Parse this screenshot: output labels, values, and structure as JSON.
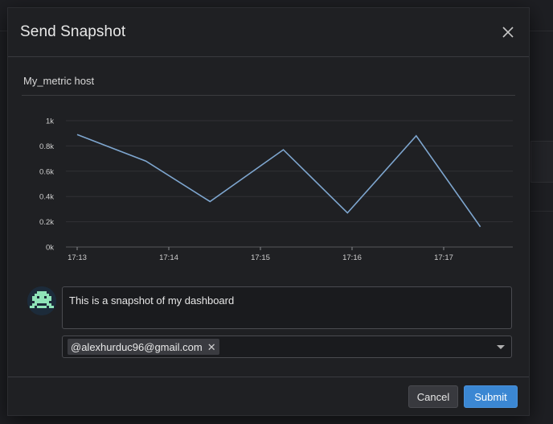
{
  "modal": {
    "title": "Send Snapshot",
    "close_icon": "close-icon"
  },
  "panel": {
    "title": "My_metric host"
  },
  "chart_data": {
    "type": "line",
    "title": "",
    "xlabel": "",
    "ylabel": "",
    "x_tick_labels": [
      "17:13",
      "17:14",
      "17:15",
      "17:16",
      "17:17"
    ],
    "y_tick_labels": [
      "0k",
      "0.2k",
      "0.4k",
      "0.6k",
      "0.8k",
      "1k"
    ],
    "ylim": [
      0,
      1000
    ],
    "grid": true,
    "series": [
      {
        "color": "#7ea6cf",
        "x": [
          0,
          0.75,
          1.45,
          2.25,
          2.95,
          3.7,
          4.4
        ],
        "values": [
          890,
          680,
          360,
          770,
          270,
          880,
          160
        ]
      }
    ]
  },
  "comment": {
    "text": "This is a snapshot of my dashboard",
    "avatar_icon": "user-avatar-icon"
  },
  "recipients": {
    "selected": "@alexhurduc96@gmail.com",
    "remove_icon": "close-icon",
    "caret_icon": "chevron-down-icon"
  },
  "footer": {
    "cancel_label": "Cancel",
    "submit_label": "Submit"
  },
  "colors": {
    "accent": "#3b87d3",
    "line": "#7ea6cf"
  }
}
